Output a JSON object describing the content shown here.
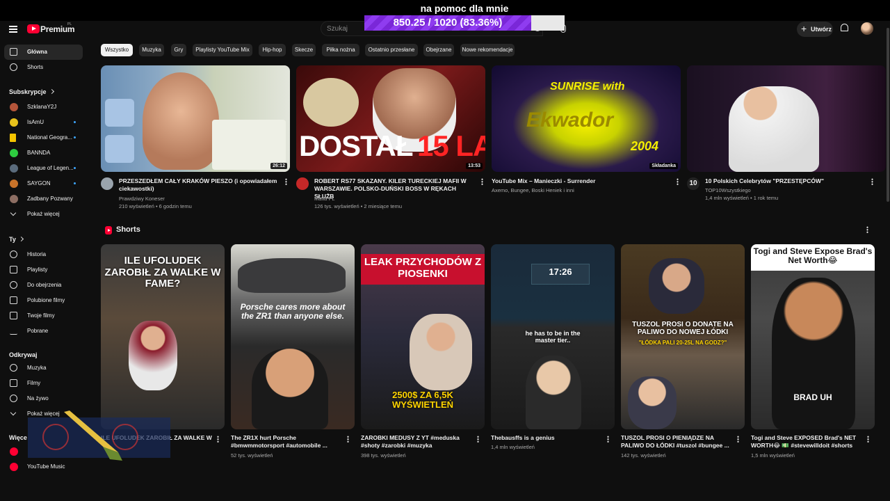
{
  "overlay": {
    "title": "na pomoc dla mnie",
    "progress_text": "850.25 / 1020 (83.36%)",
    "progress_fraction": 0.8336
  },
  "topbar": {
    "logo": "Premium",
    "logo_sup": "PL",
    "search_placeholder": "Szukaj",
    "create_label": "Utwórz"
  },
  "sidebar": {
    "main": [
      {
        "label": "Główna",
        "icon": "home-icon"
      },
      {
        "label": "Shorts",
        "icon": "shorts-icon"
      }
    ],
    "subs_header": "Subskrypcje",
    "subscriptions": [
      {
        "label": "SzklanaY2J",
        "color": "#b5553a",
        "dot": false
      },
      {
        "label": "IsAmU",
        "color": "#e8c21c",
        "dot": true
      },
      {
        "label": "National Geogra...",
        "color": "#f5c400",
        "dot": true
      },
      {
        "label": "BANNDA",
        "color": "#2ecc40",
        "dot": false
      },
      {
        "label": "League of Legen...",
        "color": "#5a6b7c",
        "dot": true
      },
      {
        "label": "SAYGON",
        "color": "#c8732a",
        "dot": true
      },
      {
        "label": "Zadbany Pozwany",
        "color": "#8d6e63",
        "dot": false
      }
    ],
    "show_more": "Pokaż więcej",
    "you_header": "Ty",
    "you_items": [
      "Historia",
      "Playlisty",
      "Do obejrzenia",
      "Polubione filmy",
      "Twoje filmy",
      "Pobrane"
    ],
    "explore_header": "Odkrywaj",
    "explore_items": [
      "Muzyka",
      "Filmy",
      "Na żywo"
    ],
    "explore_more": "Pokaż więcej",
    "more_header": "Więce",
    "youtube_music": "YouTube Music"
  },
  "chips": [
    "Wszystko",
    "Muzyka",
    "Gry",
    "Playlisty YouTube Mix",
    "Hip-hop",
    "Skecze",
    "Piłka nożna",
    "Ostatnio przesłane",
    "Obejrzane",
    "Nowe rekomendacje"
  ],
  "videos": [
    {
      "title": "PRZESZEDŁEM CAŁY KRAKÓW PIESZO (i opowiadałem ciekawostki)",
      "channel": "Prawdziwy Koneser",
      "meta": "210 wyświetleń • 6 godzin temu",
      "duration": "26:12",
      "avatar": "#9aa4ad"
    },
    {
      "title": "ROBERT RS77 SKAZANY. KILER TURECKIEJ MAFII W WARSZAWIE. POLSKO-DUŃSKI BOSS W RĘKACH SŁUŻB",
      "channel": "Mafia PL",
      "meta": "126 tys. wyświetleń • 2 miesiące temu",
      "duration": "13:53",
      "avatar": "#c62828",
      "thumb_text_1": "DOSTAŁ",
      "thumb_text_2": "15 LAT"
    },
    {
      "title": "YouTube Mix – Manieczki - Surrender",
      "channel": "Axemo, Bungee, Boski Heniek i inni",
      "meta": "",
      "duration": "Składanka",
      "thumb_text_1": "Ekwador",
      "thumb_text_2": "SUNRISE with",
      "thumb_text_3": "2004"
    },
    {
      "title": "10 Polskich Celebrytów \"PRZESTĘPCÓW\"",
      "channel": "TOP10Wszystkiego",
      "meta": "1,4 mln wyświetleń • 1 rok temu",
      "duration": "",
      "avatar": "#222",
      "avatar_text": "10"
    }
  ],
  "shorts_header": "Shorts",
  "shorts": [
    {
      "title": "ILE UFOLUDEK ZAROBIŁ ZA WALKE W",
      "views": "",
      "caption": "ILE UFOLUDEK ZAROBIŁ ZA WALKE W FAME?"
    },
    {
      "title": "The ZR1X hurt Porsche #bmwmmotorsport #automobile ...",
      "views": "52 tys. wyświetleń",
      "caption": "Porsche cares more about the ZR1 than anyone else."
    },
    {
      "title": "ZAROBKI MEDUSY Z YT #meduska #shoty #zarobki #muzyka",
      "views": "398 tys. wyświetleń",
      "caption": "LEAK PRZYCHODÓW Z PIOSENKI",
      "caption2": "2500$ ZA 6,5K WYŚWIETLEŃ"
    },
    {
      "title": "Thebausffs is a genius",
      "views": "1,4 mln wyświetleń",
      "caption": "he has to be in the master tier..",
      "timer": "17:26"
    },
    {
      "title": "TUSZOL PROSI O PIENIĄDZE NA PALIWO DO ŁÓDKI #tuszol #bungee ...",
      "views": "142 tys. wyświetleń",
      "caption": "TUSZOL PROSI O DONATE NA PALIWO DO NOWEJ ŁÓDKI",
      "caption2": "\"ŁÓDKA PALI 20-25L NA GODZ?\""
    },
    {
      "title": "Togi and Steve EXPOSED  Brad's NET WORTH😂 💵 #stevewilldoit #shorts",
      "views": "1,5 mln wyświetleń",
      "caption": "Togi and Steve Expose Brad's Net Worth😂",
      "caption2": "BRAD UH"
    }
  ]
}
